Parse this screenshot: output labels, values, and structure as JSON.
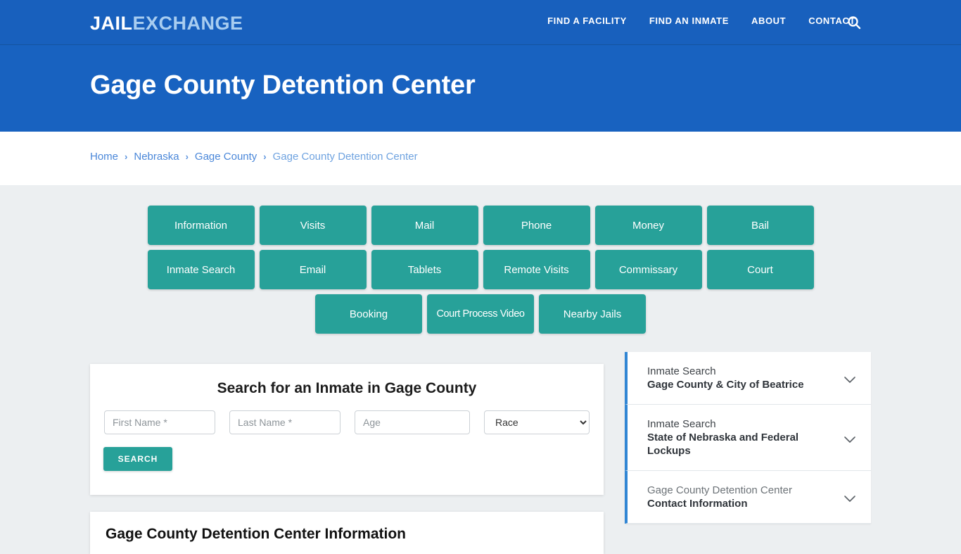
{
  "header": {
    "logo_primary": "JAIL",
    "logo_secondary": "EXCHANGE",
    "nav": [
      {
        "label": "FIND A FACILITY"
      },
      {
        "label": "FIND AN INMATE"
      },
      {
        "label": "ABOUT"
      },
      {
        "label": "CONTACT"
      }
    ],
    "search_icon": "search-icon",
    "bg_color": "#1860bd"
  },
  "hero": {
    "title": "Gage County Detention Center",
    "bg_color": "#1862c0"
  },
  "breadcrumb": {
    "separator": "›",
    "items": [
      {
        "label": "Home",
        "current": false
      },
      {
        "label": "Nebraska",
        "current": false
      },
      {
        "label": "Gage County",
        "current": false
      },
      {
        "label": "Gage County Detention Center",
        "current": true
      }
    ],
    "link_color": "#4a87d9"
  },
  "tiles": {
    "accent_color": "#27a199",
    "items": [
      {
        "label": "Information"
      },
      {
        "label": "Visits"
      },
      {
        "label": "Mail"
      },
      {
        "label": "Phone"
      },
      {
        "label": "Money"
      },
      {
        "label": "Bail"
      },
      {
        "label": "Inmate Search"
      },
      {
        "label": "Email"
      },
      {
        "label": "Tablets"
      },
      {
        "label": "Remote Visits"
      },
      {
        "label": "Commissary"
      },
      {
        "label": "Court"
      },
      {
        "label": "Booking"
      },
      {
        "label": "Court Process Video"
      },
      {
        "label": "Nearby Jails"
      }
    ]
  },
  "search_card": {
    "title": "Search for an Inmate in Gage County",
    "first_name_placeholder": "First Name *",
    "last_name_placeholder": "Last Name *",
    "age_placeholder": "Age",
    "race_selected": "Race",
    "race_options": [
      "Race"
    ],
    "submit_label": "SEARCH"
  },
  "info_card": {
    "heading": "Gage County Detention Center Information"
  },
  "sidebar": {
    "border_color": "#3186d4",
    "items": [
      {
        "line1": "Inmate Search",
        "line2": "Gage County & City of Beatrice",
        "icon": "chevron-down-icon"
      },
      {
        "line1": "Inmate Search",
        "line2": "State of Nebraska and Federal Lockups",
        "icon": "chevron-down-icon"
      },
      {
        "line1": "Gage County Detention Center",
        "line2": "Contact Information",
        "icon": "chevron-down-icon"
      }
    ]
  }
}
